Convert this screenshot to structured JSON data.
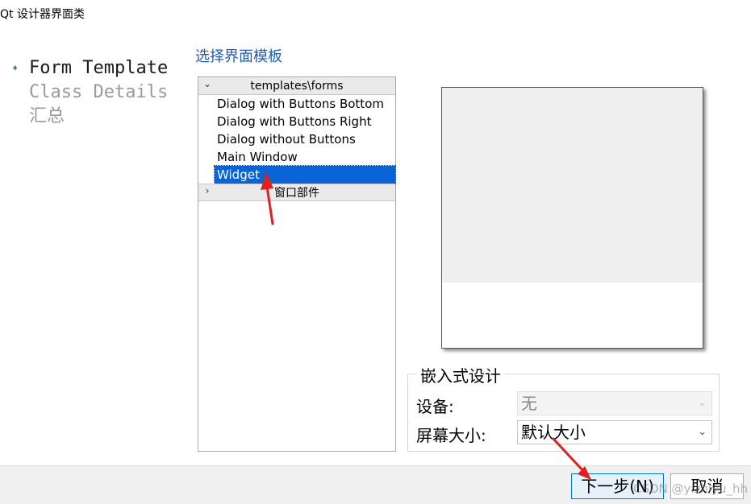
{
  "window": {
    "title": "Qt 设计器界面类"
  },
  "steps": [
    {
      "label": "Form Template",
      "state": "current"
    },
    {
      "label": "Class Details",
      "state": "pending"
    },
    {
      "label": "汇总",
      "state": "pending"
    }
  ],
  "section_title": "选择界面模板",
  "tree": {
    "group1": {
      "header": "templates\\forms",
      "items": [
        "Dialog with Buttons Bottom",
        "Dialog with Buttons Right",
        "Dialog without Buttons",
        "Main Window",
        "Widget"
      ],
      "selected_index": 4
    },
    "group2": {
      "header": "窗口部件"
    }
  },
  "embedded": {
    "title": "嵌入式设计",
    "device_label": "设备:",
    "device_value": "无",
    "screen_label": "屏幕大小:",
    "screen_value": "默认大小"
  },
  "buttons": {
    "next": "下一步(N)",
    "cancel": "取消"
  },
  "watermark": "CSDN @yizhiyu_hh",
  "colors": {
    "selection": "#0a64d6",
    "section_title": "#1f5cb8",
    "annotation_arrow": "#e02020"
  }
}
